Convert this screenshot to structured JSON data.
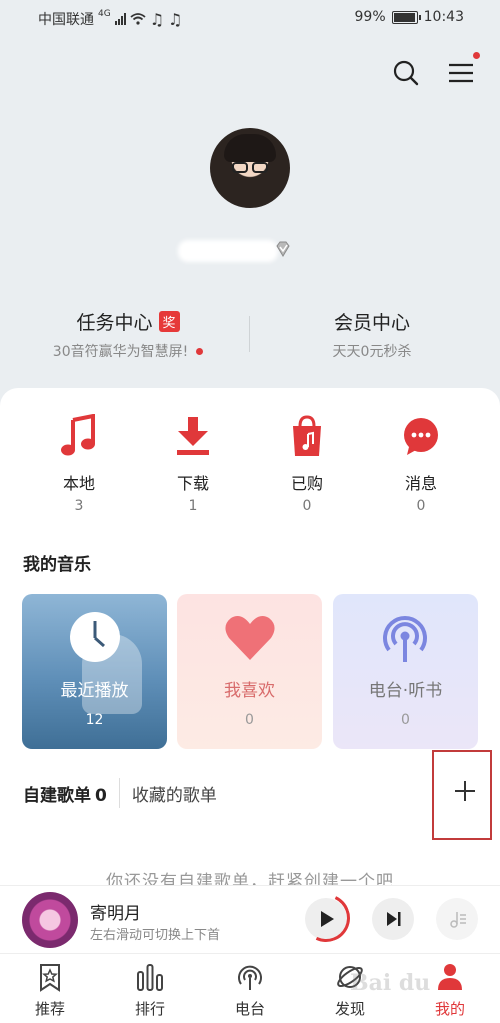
{
  "status_bar": {
    "carrier": "中国联通",
    "network": "4G",
    "battery": "99%",
    "time": "10:43"
  },
  "header": {
    "search_icon": "search-icon",
    "menu_icon": "hamburger-menu-icon"
  },
  "profile": {
    "avatar": "user-avatar",
    "username": ""
  },
  "task_center": {
    "title": "任务中心",
    "badge": "奖",
    "subtitle": "30音符赢华为智慧屏!"
  },
  "vip_center": {
    "title": "会员中心",
    "subtitle": "天天0元秒杀"
  },
  "quick_items": [
    {
      "label": "本地",
      "count": "3",
      "icon": "music-note-icon"
    },
    {
      "label": "下载",
      "count": "1",
      "icon": "download-icon"
    },
    {
      "label": "已购",
      "count": "0",
      "icon": "shopping-bag-icon"
    },
    {
      "label": "消息",
      "count": "0",
      "icon": "message-bubble-icon"
    }
  ],
  "my_music": {
    "title": "我的音乐",
    "tiles": [
      {
        "label": "最近播放",
        "count": "12",
        "icon": "clock-icon"
      },
      {
        "label": "我喜欢",
        "count": "0",
        "icon": "heart-icon"
      },
      {
        "label": "电台·听书",
        "count": "0",
        "icon": "radio-icon"
      }
    ]
  },
  "playlists": {
    "created_label": "自建歌单",
    "created_count": "0",
    "favorited_label": "收藏的歌单",
    "empty_tip": "你还没有自建歌单，赶紧创建一个吧"
  },
  "player": {
    "title": "寄明月",
    "subtitle": "左右滑动可切换上下首"
  },
  "tabs": [
    {
      "label": "推荐",
      "icon": "star-bookmark-icon"
    },
    {
      "label": "排行",
      "icon": "bar-chart-icon"
    },
    {
      "label": "电台",
      "icon": "radio-icon"
    },
    {
      "label": "发现",
      "icon": "planet-icon"
    },
    {
      "label": "我的",
      "icon": "person-icon"
    }
  ],
  "colors": {
    "accent": "#e0383a",
    "background_top": "#eaeef1"
  }
}
